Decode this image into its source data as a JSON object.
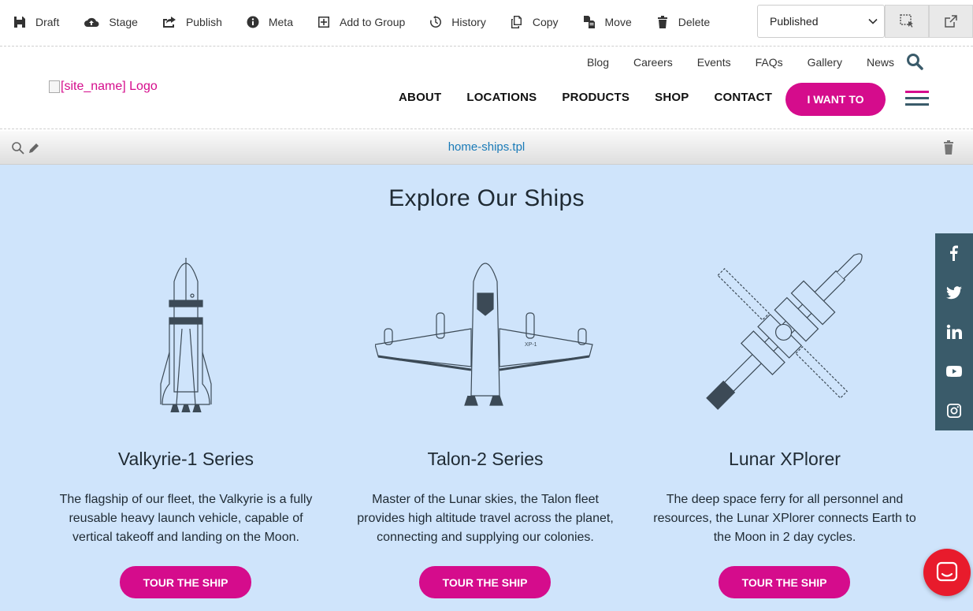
{
  "toolbar": {
    "items": [
      {
        "label": "Draft",
        "icon": "save-icon"
      },
      {
        "label": "Stage",
        "icon": "cloud-upload-icon"
      },
      {
        "label": "Publish",
        "icon": "share-icon"
      },
      {
        "label": "Meta",
        "icon": "info-icon"
      },
      {
        "label": "Add to Group",
        "icon": "plus-square-icon"
      },
      {
        "label": "History",
        "icon": "history-icon"
      },
      {
        "label": "Copy",
        "icon": "copy-icon"
      },
      {
        "label": "Move",
        "icon": "move-icon"
      },
      {
        "label": "Delete",
        "icon": "trash-icon"
      }
    ],
    "status_select": {
      "value": "Published"
    }
  },
  "header": {
    "logo_alt": "[site_name] Logo",
    "util_nav": [
      "Blog",
      "Careers",
      "Events",
      "FAQs",
      "Gallery",
      "News"
    ],
    "main_nav": [
      "ABOUT",
      "LOCATIONS",
      "PRODUCTS",
      "SHOP",
      "CONTACT"
    ],
    "cta_label": "I WANT TO"
  },
  "template_bar": {
    "name": "home-ships.tpl"
  },
  "section": {
    "title": "Explore Our Ships",
    "cards": [
      {
        "title": "Valkyrie-1 Series",
        "text": "The flagship of our fleet, the Valkyrie is a fully reusable heavy launch vehicle, capable of vertical takeoff and landing on the Moon.",
        "button": "TOUR THE SHIP"
      },
      {
        "title": "Talon-2 Series",
        "text": "Master of the Lunar skies, the Talon fleet provides high altitude travel across the planet, connecting and supplying our colonies.",
        "button": "TOUR THE SHIP"
      },
      {
        "title": "Lunar XPlorer",
        "text": "The deep space ferry for all personnel and resources, the Lunar XPlorer connects Earth to the Moon in 2 day cycles.",
        "button": "TOUR THE SHIP"
      }
    ]
  },
  "social": [
    "facebook-icon",
    "twitter-icon",
    "linkedin-icon",
    "youtube-icon",
    "instagram-icon"
  ],
  "colors": {
    "brand": "#d50c8c",
    "section_bg": "#cfe4fb",
    "social_bg": "#3a5b6a",
    "chat": "#e81b2c",
    "link": "#1a7bb8"
  }
}
